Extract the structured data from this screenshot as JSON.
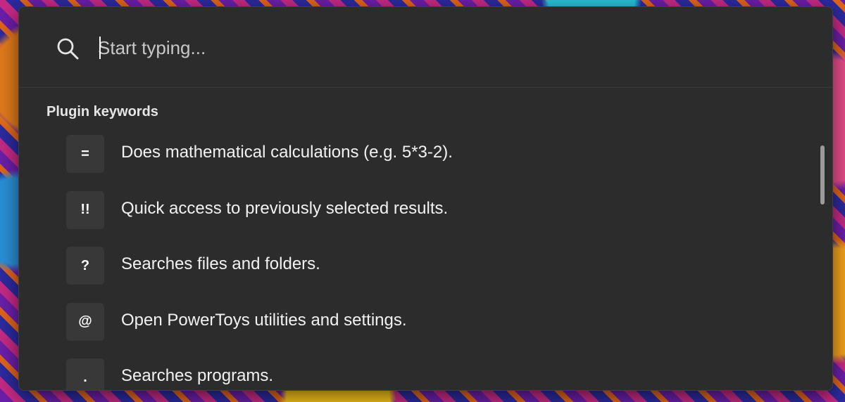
{
  "search": {
    "placeholder": "Start typing...",
    "value": ""
  },
  "section": {
    "title": "Plugin keywords"
  },
  "plugins": [
    {
      "keyword": "=",
      "description": "Does mathematical calculations (e.g. 5*3-2)."
    },
    {
      "keyword": "!!",
      "description": "Quick access to previously selected results."
    },
    {
      "keyword": "?",
      "description": "Searches files and folders."
    },
    {
      "keyword": "@",
      "description": "Open PowerToys utilities and settings."
    },
    {
      "keyword": ".",
      "description": "Searches programs."
    }
  ],
  "icons": {
    "search": "search-icon"
  },
  "colors": {
    "panel": "#2c2c2c",
    "badge": "#383838",
    "text": "#f2f2f2"
  }
}
